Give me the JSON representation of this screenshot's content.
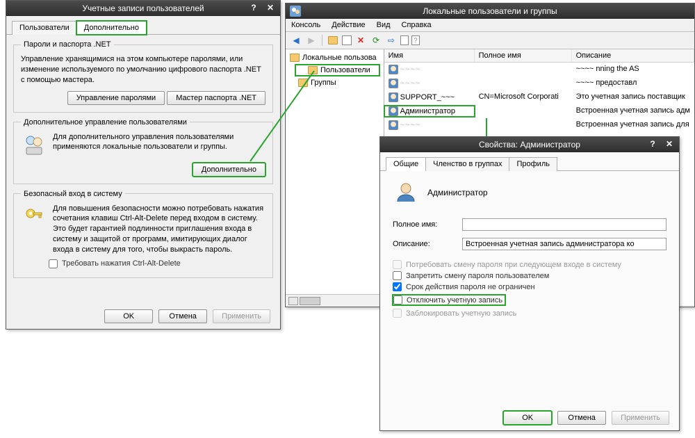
{
  "left_window": {
    "title": "Учетные записи пользователей",
    "help_btn": "?",
    "close_btn": "✕",
    "tabs": [
      "Пользователи",
      "Дополнительно"
    ],
    "group1": {
      "legend": "Пароли и паспорта .NET",
      "desc": "Управление хранящимися на этом компьютере паролями, или изменение используемого по умолчанию цифрового паспорта .NET с помощью мастера.",
      "btn1": "Управление паролями",
      "btn2": "Мастер паспорта .NET"
    },
    "group2": {
      "legend": "Дополнительное управление пользователями",
      "desc": "Для дополнительного управления пользователями применяются локальные пользователи и группы.",
      "btn": "Дополнительно"
    },
    "group3": {
      "legend": "Безопасный вход в систему",
      "desc": "Для повышения безопасности можно потребовать нажатия сочетания клавиш Ctrl-Alt-Delete перед входом в систему. Это будет гарантией подлинности приглашения входа в систему и защитой от программ, имитирующих диалог входа в систему для того, чтобы выкрасть пароль.",
      "chk": "Требовать нажатия Ctrl-Alt-Delete"
    },
    "buttons": {
      "ok": "OK",
      "cancel": "Отмена",
      "apply": "Применить"
    }
  },
  "mmc": {
    "title": "Локальные пользователи и группы",
    "menus": [
      "Консоль",
      "Действие",
      "Вид",
      "Справка"
    ],
    "tree_root": "Локальные пользова",
    "tree_users": "Пользователи",
    "tree_groups": "Группы",
    "cols": {
      "name": "Имя",
      "fullname": "Полное имя",
      "desc": "Описание"
    },
    "rows": [
      {
        "name": "~~~~",
        "full": "",
        "desc": "~~~~ nning the AS"
      },
      {
        "name": "~~~~",
        "full": "",
        "desc": "~~~~ предоставл"
      },
      {
        "name": "SUPPORT_~~~",
        "full": "CN=Microsoft Corporati",
        "desc": "Это учетная запись поставщик"
      },
      {
        "name": "Администратор",
        "full": "",
        "desc": "Встроенная учетная запись адм"
      },
      {
        "name": "~~~~",
        "full": "",
        "desc": "Встроенная учетная запись для"
      }
    ]
  },
  "props": {
    "title": "Свойства: Администратор",
    "help_btn": "?",
    "close_btn": "✕",
    "tabs": [
      "Общие",
      "Членство в группах",
      "Профиль"
    ],
    "heading": "Администратор",
    "label_fullname": "Полное имя:",
    "label_desc": "Описание:",
    "desc_value": "Встроенная учетная запись администратора ко",
    "chk1": "Потребовать смену пароля при следующем входе в систему",
    "chk2": "Запретить смену пароля пользователем",
    "chk3": "Срок действия пароля не ограничен",
    "chk4": "Отключить учетную запись",
    "chk5": "Заблокировать учетную запись",
    "buttons": {
      "ok": "OK",
      "cancel": "Отмена",
      "apply": "Применить"
    }
  }
}
